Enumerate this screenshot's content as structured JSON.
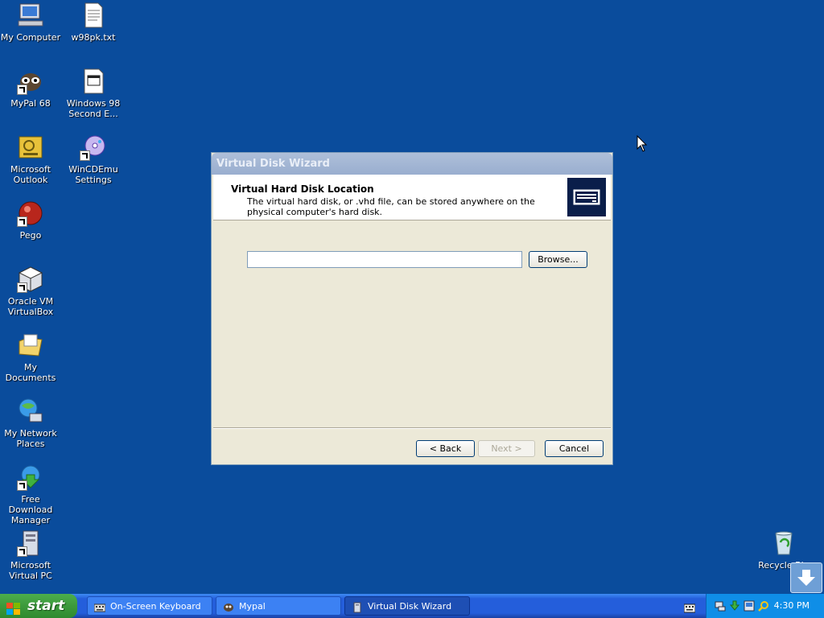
{
  "desktop": {
    "icons": [
      {
        "label": "My Computer",
        "icon": "my-computer-icon"
      },
      {
        "label": "w98pk.txt",
        "icon": "text-file-icon"
      },
      {
        "label": "MyPal 68",
        "icon": "mypal-icon"
      },
      {
        "label": "Windows 98 Second E...",
        "icon": "disc-image-icon"
      },
      {
        "label": "Microsoft Outlook",
        "icon": "outlook-icon"
      },
      {
        "label": "WinCDEmu Settings",
        "icon": "wincdemu-icon"
      },
      {
        "label": "Pego",
        "icon": "pego-icon"
      },
      {
        "label": "Oracle VM VirtualBox",
        "icon": "virtualbox-icon"
      },
      {
        "label": "My Documents",
        "icon": "my-documents-icon"
      },
      {
        "label": "My Network Places",
        "icon": "network-places-icon"
      },
      {
        "label": "Free Download Manager",
        "icon": "fdm-icon"
      },
      {
        "label": "Microsoft Virtual PC",
        "icon": "virtual-pc-icon"
      },
      {
        "label": "Recycle Bin",
        "icon": "recycle-bin-icon"
      }
    ]
  },
  "wizard": {
    "title": "Virtual Disk Wizard",
    "heading": "Virtual Hard Disk Location",
    "description": "The virtual hard disk, or .vhd file, can be stored anywhere on the physical computer's hard disk.",
    "path_value": "",
    "browse_label": "Browse...",
    "back_label": "< Back",
    "next_label": "Next >",
    "cancel_label": "Cancel"
  },
  "taskbar": {
    "start_label": "start",
    "tasks": [
      {
        "label": "On-Screen Keyboard",
        "icon": "keyboard-icon"
      },
      {
        "label": "Mypal",
        "icon": "mypal-icon"
      },
      {
        "label": "Virtual Disk Wizard",
        "icon": "virtual-pc-icon",
        "active": true
      }
    ],
    "clock": "4:30 PM"
  }
}
